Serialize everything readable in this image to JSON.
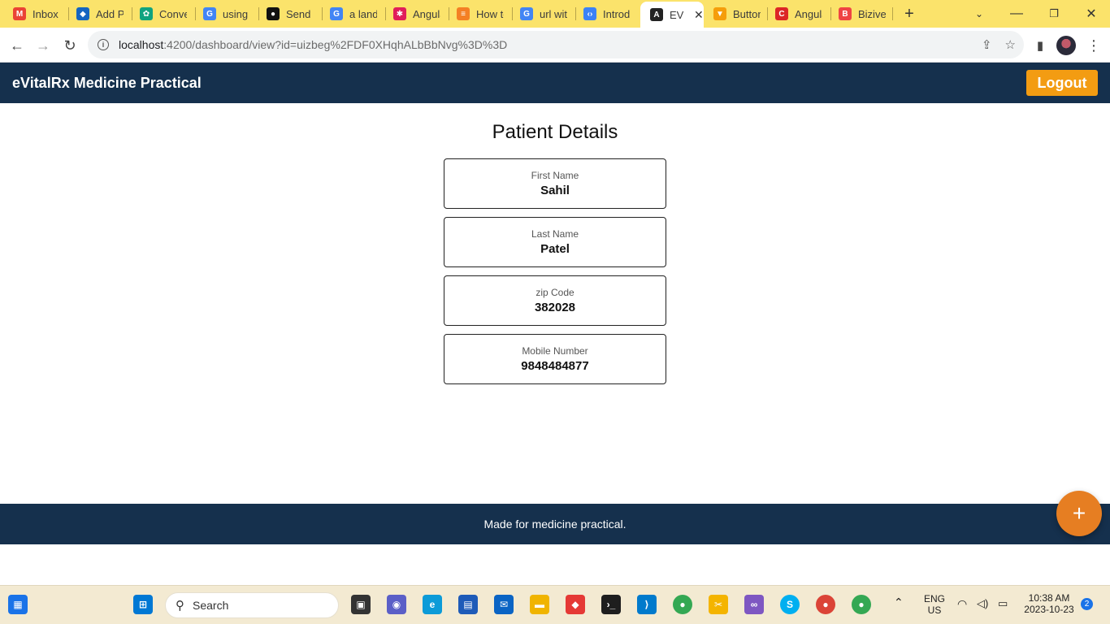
{
  "browser": {
    "tabs": [
      {
        "label": "Inbox (",
        "icon": "gmail-icon",
        "color": "#ea4335"
      },
      {
        "label": "Add Pa",
        "icon": "azure-icon",
        "color": "#1565c0"
      },
      {
        "label": "Conver",
        "icon": "chatgpt-icon",
        "color": "#10a37f"
      },
      {
        "label": "using p",
        "icon": "google-icon",
        "color": "#4285f4"
      },
      {
        "label": "Send H",
        "icon": "medium-icon",
        "color": "#111111"
      },
      {
        "label": "a landi",
        "icon": "google-icon",
        "color": "#4285f4"
      },
      {
        "label": "Angula",
        "icon": "slack-icon",
        "color": "#e01e5a"
      },
      {
        "label": "How to",
        "icon": "stackoverflow-icon",
        "color": "#f48024"
      },
      {
        "label": "url with",
        "icon": "google-icon",
        "color": "#4285f4"
      },
      {
        "label": "Introdu",
        "icon": "code-icon",
        "color": "#3b82f6"
      },
      {
        "label": "EV",
        "icon": "angular-icon",
        "color": "#222222"
      },
      {
        "label": "Button",
        "icon": "brave-icon",
        "color": "#f59e0b"
      },
      {
        "label": "Angula",
        "icon": "codecademy-icon",
        "color": "#dc2626"
      },
      {
        "label": "Biziver",
        "icon": "bizi-icon",
        "color": "#ef4444"
      }
    ],
    "url_host": "localhost",
    "url_rest": ":4200/dashboard/view?id=uizbeg%2FDF0XHqhALbBbNvg%3D%3D"
  },
  "header": {
    "title": "eVitalRx Medicine Practical",
    "logout_label": "Logout"
  },
  "main": {
    "title": "Patient Details",
    "fields": [
      {
        "label": "First Name",
        "value": "Sahil"
      },
      {
        "label": "Last Name",
        "value": "Patel"
      },
      {
        "label": "zip Code",
        "value": "382028"
      },
      {
        "label": "Mobile Number",
        "value": "9848484877"
      }
    ]
  },
  "footer": {
    "text": "Made for medicine practical.",
    "fab_label": "+"
  },
  "taskbar": {
    "search_placeholder": "Search",
    "lang_top": "ENG",
    "lang_bottom": "US",
    "time": "10:38 AM",
    "date": "2023-10-23",
    "notification_count": "2"
  },
  "colors": {
    "header_bg": "#15304d",
    "logout_bg": "#f39c12",
    "fab_bg": "#e67e22",
    "tabstrip_bg": "#fbe36b"
  }
}
